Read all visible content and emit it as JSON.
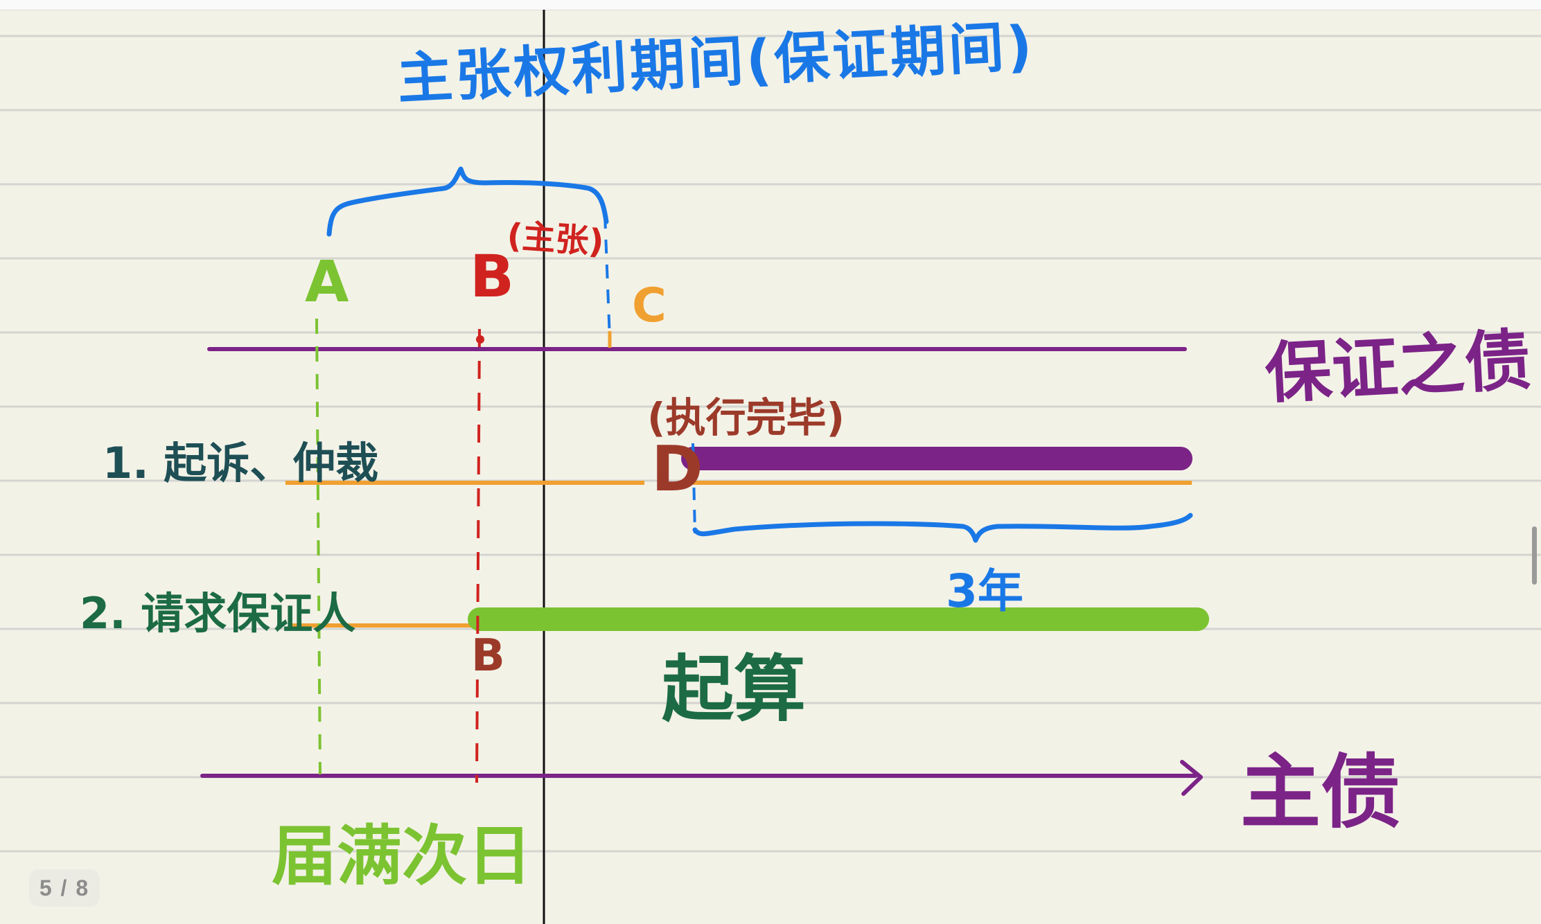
{
  "notebook": {
    "page_indicator": "5 / 8",
    "colors": {
      "paper": "#f3f2e7",
      "ruled_line": "#d4d4d0",
      "center_line": "#111111",
      "blue": "#1a78e6",
      "green": "#7cc332",
      "red": "#d0231f",
      "orange": "#f0a030",
      "purple": "#7b2387",
      "dark_red": "#9c3a2a",
      "dark_teal": "#1e4f55",
      "dark_green": "#1c6b45"
    }
  },
  "diagram": {
    "heading": "主张权利期间(保证期间)",
    "point_labels": {
      "A": "A",
      "B_top": "B",
      "C": "C",
      "D": "D",
      "B_bottom": "B"
    },
    "annotations": {
      "claim": "(主张)",
      "execution_done": "(执行完毕)",
      "three_years": "3年",
      "start_counting": "起算",
      "due_next_day": "届满次日"
    },
    "row_labels": {
      "guarantee_debt": "保证之债",
      "main_debt": "主债",
      "option_1": "1. 起诉、仲裁",
      "option_2": "2. 请求保证人"
    }
  }
}
